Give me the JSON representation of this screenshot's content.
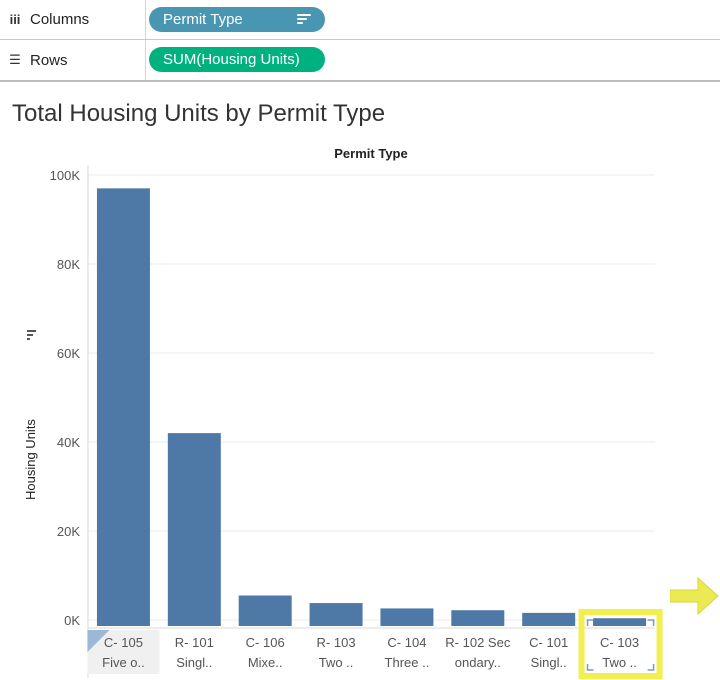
{
  "shelves": {
    "columns": {
      "label": "Columns",
      "icon": "columns-icon",
      "pill": "Permit Type",
      "pill_color": "#4996b2"
    },
    "rows": {
      "label": "Rows",
      "icon": "rows-icon",
      "pill": "SUM(Housing Units)",
      "pill_color": "#00b180"
    }
  },
  "title": "Total Housing Units by Permit Type",
  "chart_data": {
    "type": "bar",
    "column_header": "Permit Type",
    "ylabel": "Housing Units",
    "ylim": [
      0,
      100000
    ],
    "y_ticks": [
      "0K",
      "20K",
      "40K",
      "60K",
      "80K",
      "100K"
    ],
    "bar_color": "#4e79a7",
    "categories": [
      [
        "C- 105",
        "Five o.."
      ],
      [
        "R- 101",
        "Singl.."
      ],
      [
        "C- 106",
        "Mixe.."
      ],
      [
        "R- 103",
        "Two .."
      ],
      [
        "C- 104",
        "Three .."
      ],
      [
        "R- 102 Sec",
        "ondary.."
      ],
      [
        "C- 101",
        "Singl.."
      ],
      [
        "C- 103",
        "Two .."
      ]
    ],
    "values": [
      97000,
      42000,
      5500,
      3800,
      2600,
      2200,
      1600,
      400
    ],
    "selected_index": 7,
    "highlight_color": "#f2ef4f"
  }
}
